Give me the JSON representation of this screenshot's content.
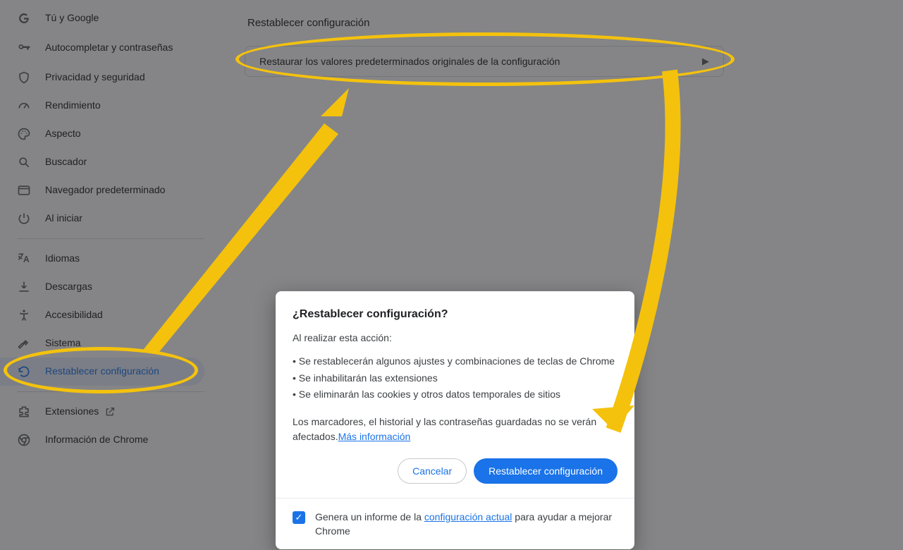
{
  "sidebar": {
    "items": [
      {
        "label": "Tú y Google"
      },
      {
        "label": "Autocompletar y contraseñas"
      },
      {
        "label": "Privacidad y seguridad"
      },
      {
        "label": "Rendimiento"
      },
      {
        "label": "Aspecto"
      },
      {
        "label": "Buscador"
      },
      {
        "label": "Navegador predeterminado"
      },
      {
        "label": "Al iniciar"
      }
    ],
    "items2": [
      {
        "label": "Idiomas"
      },
      {
        "label": "Descargas"
      },
      {
        "label": "Accesibilidad"
      },
      {
        "label": "Sistema"
      },
      {
        "label": "Restablecer configuración"
      }
    ],
    "items3": [
      {
        "label": "Extensiones"
      },
      {
        "label": "Información de Chrome"
      }
    ]
  },
  "main": {
    "section_title": "Restablecer configuración",
    "row_label": "Restaurar los valores predeterminados originales de la configuración"
  },
  "dialog": {
    "title": "¿Restablecer configuración?",
    "lead": "Al realizar esta acción:",
    "bullets": [
      "Se restablecerán algunos ajustes y combinaciones de teclas de Chrome",
      "Se inhabilitarán las extensiones",
      "Se eliminarán las cookies y otros datos temporales de sitios"
    ],
    "keep_prefix": "Los marcadores, el historial y las contraseñas guardadas no se verán afectados.",
    "keep_link": "Más información",
    "cancel": "Cancelar",
    "confirm": "Restablecer configuración",
    "foot_prefix": "Genera un informe de la ",
    "foot_link": "configuración actual",
    "foot_suffix": " para ayudar a mejorar Chrome"
  }
}
